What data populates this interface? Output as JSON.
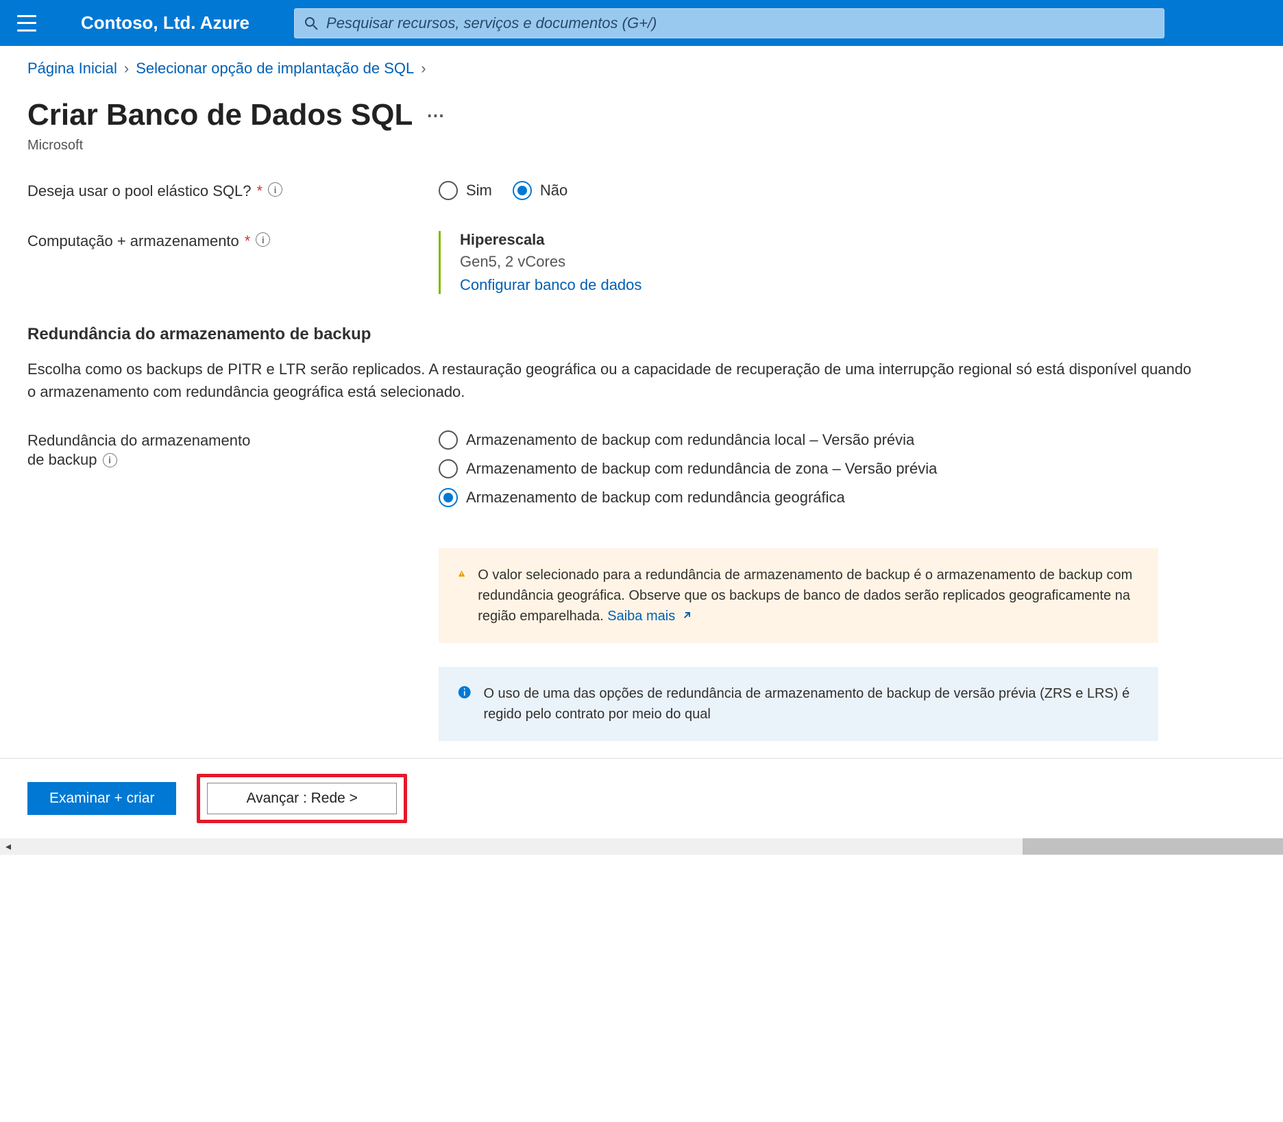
{
  "header": {
    "brand": "Contoso, Ltd. Azure",
    "search_placeholder": "Pesquisar recursos, serviços e documentos (G+/)"
  },
  "breadcrumb": {
    "items": [
      "Página Inicial",
      "Selecionar opção de implantação de SQL"
    ]
  },
  "page": {
    "title": "Criar Banco de Dados SQL",
    "subtitle": "Microsoft"
  },
  "form": {
    "elastic_label": "Deseja usar o pool elástico SQL?",
    "elastic_yes": "Sim",
    "elastic_no": "Não",
    "compute_label": "Computação + armazenamento",
    "compute_tier": "Hiperescala",
    "compute_detail": "Gen5, 2 vCores",
    "compute_link": "Configurar banco de dados"
  },
  "backup": {
    "heading": "Redundância do armazenamento de backup",
    "description": "Escolha como os backups de PITR e LTR serão replicados. A restauração geográfica ou a capacidade de recuperação de uma interrupção regional só está disponível quando o armazenamento com redundância geográfica está selecionado.",
    "field_label_line1": "Redundância do armazenamento",
    "field_label_line2": "de backup",
    "option_local": "Armazenamento de backup com redundância local – Versão prévia",
    "option_zone": "Armazenamento de backup com redundância de zona – Versão prévia",
    "option_geo": "Armazenamento de backup com redundância geográfica",
    "warning_text": "O valor selecionado para a redundância de armazenamento de backup é o armazenamento de backup com redundância geográfica. Observe que os backups de banco de dados serão replicados geograficamente na região emparelhada. ",
    "warning_link": "Saiba mais",
    "info_text": "O uso de uma das opções de redundância de armazenamento de backup de versão prévia (ZRS e LRS) é regido pelo contrato por meio do qual"
  },
  "footer": {
    "review_create": "Examinar + criar",
    "next": "Avançar : Rede >"
  }
}
